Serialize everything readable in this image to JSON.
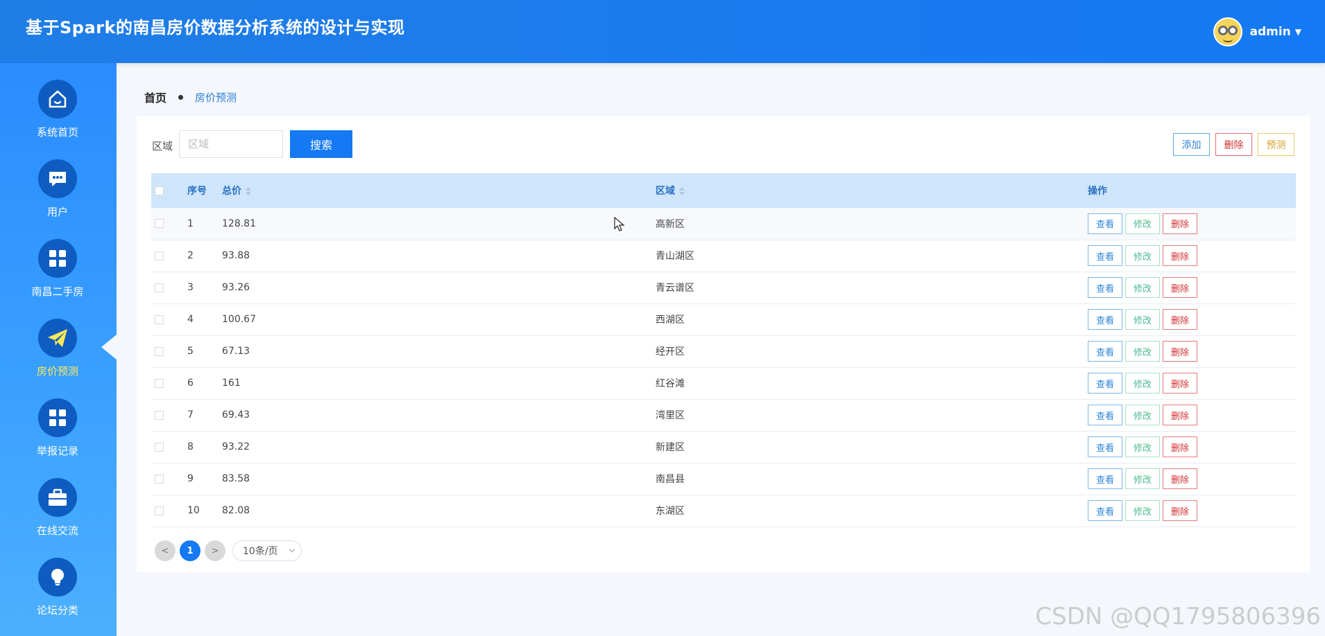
{
  "header": {
    "title": "基于Spark的南昌房价数据分析系统的设计与实现",
    "user": "admin"
  },
  "sidebar": {
    "items": [
      {
        "label": "系统首页",
        "icon": "home-icon",
        "active": false
      },
      {
        "label": "用户",
        "icon": "chat-icon",
        "active": false
      },
      {
        "label": "南昌二手房",
        "icon": "grid-icon",
        "active": false
      },
      {
        "label": "房价预测",
        "icon": "paper-plane-icon",
        "active": true
      },
      {
        "label": "举报记录",
        "icon": "grid-icon",
        "active": false
      },
      {
        "label": "在线交流",
        "icon": "briefcase-icon",
        "active": false
      },
      {
        "label": "论坛分类",
        "icon": "lightbulb-icon",
        "active": false
      }
    ]
  },
  "breadcrumb": {
    "home": "首页",
    "current": "房价预测"
  },
  "search": {
    "label": "区域",
    "placeholder": "区域",
    "value": "",
    "button": "搜索"
  },
  "toolbar": {
    "add": "添加",
    "delete": "删除",
    "predict": "预测"
  },
  "table": {
    "headers": {
      "index": "序号",
      "total_price": "总价",
      "district": "区域",
      "operations": "操作"
    },
    "actions": {
      "view": "查看",
      "edit": "修改",
      "delete": "删除"
    },
    "rows": [
      {
        "index": "1",
        "total_price": "128.81",
        "district": "高新区"
      },
      {
        "index": "2",
        "total_price": "93.88",
        "district": "青山湖区"
      },
      {
        "index": "3",
        "total_price": "93.26",
        "district": "青云谱区"
      },
      {
        "index": "4",
        "total_price": "100.67",
        "district": "西湖区"
      },
      {
        "index": "5",
        "total_price": "67.13",
        "district": "经开区"
      },
      {
        "index": "6",
        "total_price": "161",
        "district": "红谷滩"
      },
      {
        "index": "7",
        "total_price": "69.43",
        "district": "湾里区"
      },
      {
        "index": "8",
        "total_price": "93.22",
        "district": "新建区"
      },
      {
        "index": "9",
        "total_price": "83.58",
        "district": "南昌县"
      },
      {
        "index": "10",
        "total_price": "82.08",
        "district": "东湖区"
      }
    ]
  },
  "pagination": {
    "prev": "<",
    "current_page": "1",
    "next": ">",
    "page_size": "10条/页"
  },
  "watermark": "CSDN @QQ1795806396"
}
